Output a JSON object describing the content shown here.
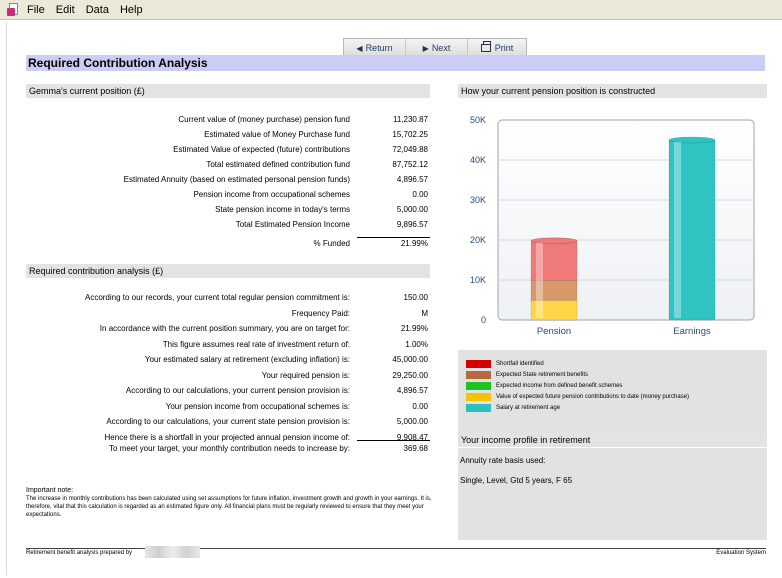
{
  "menu": [
    "File",
    "Edit",
    "Data",
    "Help"
  ],
  "toolbar": {
    "return_label": "Return",
    "next_label": "Next",
    "print_label": "Print"
  },
  "page_title": "Required Contribution Analysis",
  "current_position": {
    "heading": "Gemma's current position (£)",
    "rows": [
      {
        "label": "Current value of (money purchase) pension fund",
        "value": "11,230.87"
      },
      {
        "label": "Estimated value of Money Purchase fund",
        "value": "15,702.25"
      },
      {
        "label": "Estimated Value of expected (future) contributions",
        "value": "72,049.88"
      },
      {
        "label": "Total estimated defined contribution fund",
        "value": "87,752.12"
      },
      {
        "label": "Estimated Annuity (based on estimated personal pension funds)",
        "value": "4,896.57"
      },
      {
        "label": "Pension income from occupational schemes",
        "value": "0.00"
      },
      {
        "label": "State pension income in today's terms",
        "value": "5,000.00"
      },
      {
        "label": "Total Estimated Pension Income",
        "value": "9,896.57"
      }
    ],
    "funded_label": "% Funded",
    "funded_value": "21.99%"
  },
  "required_analysis": {
    "heading": "Required contribution analysis (£)",
    "rows": [
      {
        "label": "According to our records, your current total regular pension commitment is:",
        "value": "150.00"
      },
      {
        "label": "Frequency Paid:",
        "value": "M"
      },
      {
        "label": "In accordance with the current position summary, you are on target for:",
        "value": "21.99%"
      },
      {
        "label": "This figure assumes real rate of investment return of:",
        "value": "1.00%"
      },
      {
        "label": "Your estimated salary at retirement (excluding inflation) is:",
        "value": "45,000.00"
      },
      {
        "label": "Your required pension is:",
        "value": "29,250.00"
      },
      {
        "label": "According to our calculations, your current pension provision is:",
        "value": "4,896.57"
      },
      {
        "label": "Your pension income from occupational schemes is:",
        "value": "0.00"
      },
      {
        "label": "According to our calculations, your current state pension provision is:",
        "value": "5,000.00"
      },
      {
        "label": "Hence there is a shortfall in your projected annual pension income of:",
        "value": "9,908.47"
      }
    ],
    "target_label": "To meet your target, your monthly contribution needs to increase by:",
    "target_value": "369.68"
  },
  "chart_heading": "How your current pension position is constructed",
  "chart_data": {
    "type": "bar",
    "categories": [
      "Pension",
      "Earnings"
    ],
    "ylim": [
      0,
      50000
    ],
    "yticks": [
      {
        "v": 0,
        "t": "0"
      },
      {
        "v": 10000,
        "t": "10K"
      },
      {
        "v": 20000,
        "t": "20K"
      },
      {
        "v": 30000,
        "t": "30K"
      },
      {
        "v": 40000,
        "t": "40K"
      },
      {
        "v": 50000,
        "t": "50K"
      }
    ],
    "series": [
      {
        "name": "Value of expected future pension contributions to date (money purchase)",
        "color": "#ffd447",
        "values": [
          4896.57,
          0
        ]
      },
      {
        "name": "Expected State retirement benefits",
        "color": "#d9986a",
        "values": [
          5000,
          0
        ]
      },
      {
        "name": "Expected income from defined benefit schemes",
        "color": "#3fd13f",
        "values": [
          0,
          0
        ]
      },
      {
        "name": "Shortfall identified",
        "color": "#f07a7a",
        "values": [
          9908.47,
          0
        ]
      },
      {
        "name": "Salary at retirement age",
        "color": "#2fc4c2",
        "values": [
          0,
          45000
        ]
      }
    ]
  },
  "legend": [
    {
      "label": "Shortfall identified",
      "color": "#d40000"
    },
    {
      "label": "Expected State retirement benefits",
      "color": "#b56b3d"
    },
    {
      "label": "Expected income from defined benefit schemes",
      "color": "#1ec51e"
    },
    {
      "label": "Value of expected future pension contributions to date (money purchase)",
      "color": "#f5c400"
    },
    {
      "label": "Salary at retirement age",
      "color": "#2dbfbf"
    }
  ],
  "income_profile": {
    "heading": "Your income profile in retirement",
    "basis_label": "Annuity rate basis used:",
    "basis_value": "Single, Level, Gtd 5 years, F 65"
  },
  "note": {
    "title": "Important note:",
    "text": "The increase in monthly contributions has been calculated using set assumptions for future inflation, investment growth and growth in your earnings. It is, therefore, vital that this calculation is regarded as an estimated figure only. All financial plans must be regularly reviewed to ensure that they meet your expectations."
  },
  "footer": {
    "left": "Retirement benefit analysis prepared by",
    "right": "Evaluation System"
  }
}
